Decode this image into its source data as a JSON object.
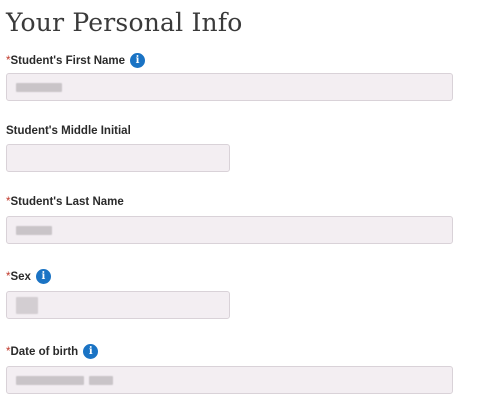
{
  "page": {
    "title": "Your Personal Info"
  },
  "required_marker": "*",
  "fields": {
    "first_name": {
      "label": "Student's First Name",
      "required": true,
      "has_info": true
    },
    "middle_initial": {
      "label": "Student's Middle Initial",
      "required": false,
      "has_info": false
    },
    "last_name": {
      "label": "Student's Last Name",
      "required": true,
      "has_info": true
    },
    "sex": {
      "label": "Sex",
      "required": true,
      "has_info": true
    },
    "dob": {
      "label": "Date of birth",
      "required": true,
      "has_info": true
    }
  },
  "icons": {
    "info": "info-icon"
  },
  "colors": {
    "required": "#c0392b",
    "info": "#1a73c4",
    "field_bg": "#f3eef2"
  }
}
